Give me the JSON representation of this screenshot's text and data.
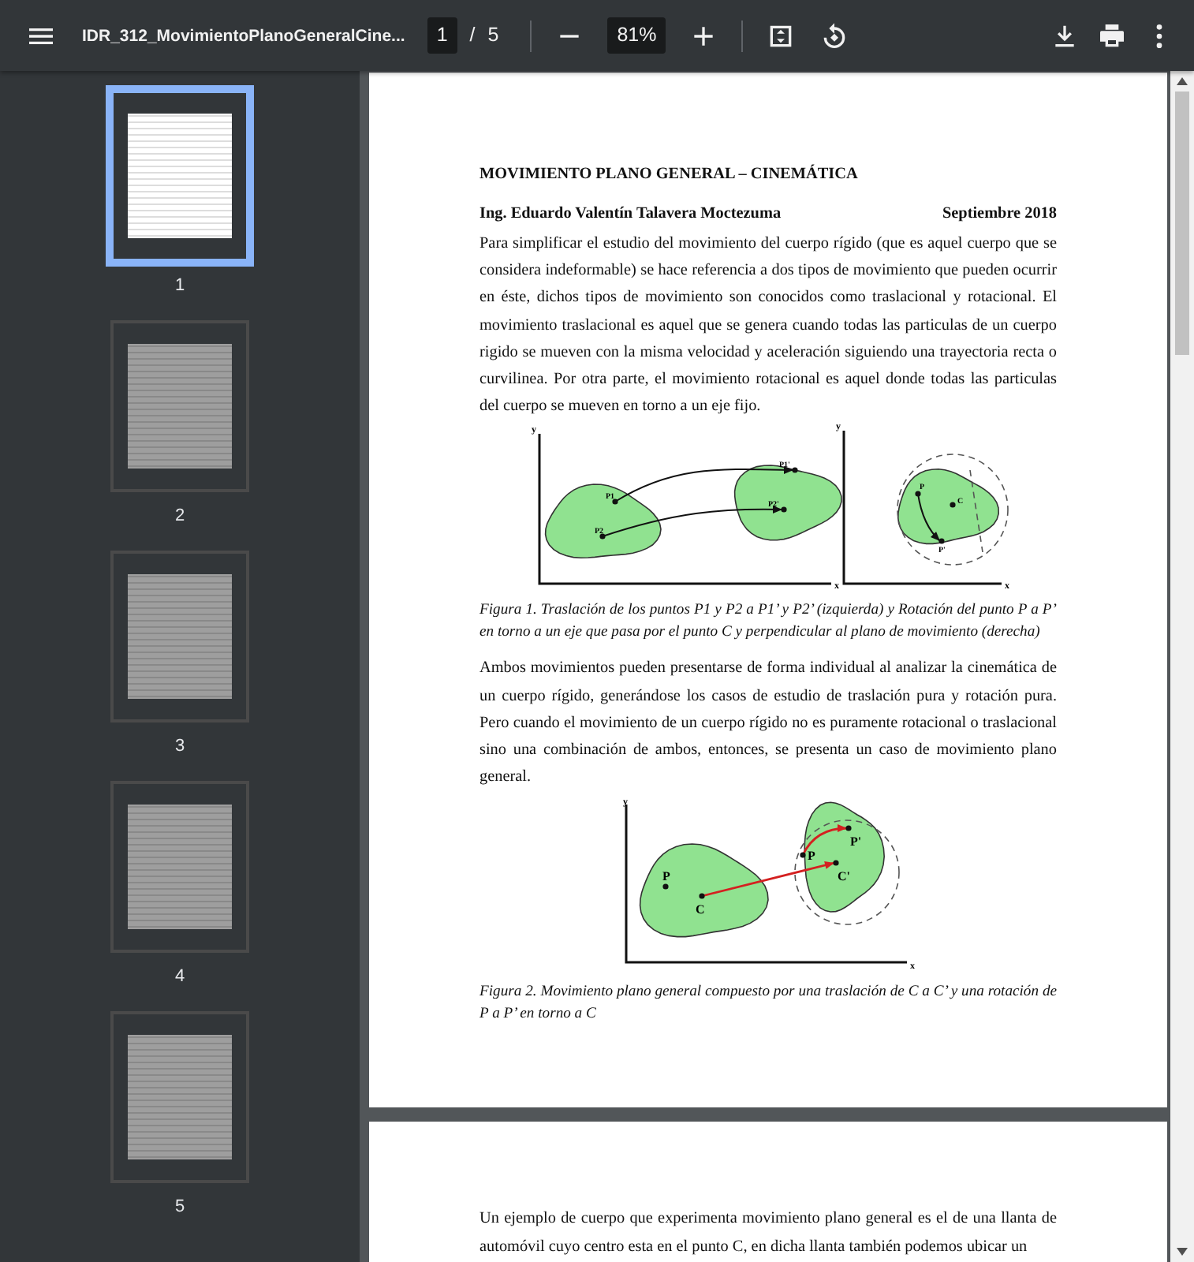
{
  "toolbar": {
    "title": "IDR_312_MovimientoPlanoGeneralCine...",
    "page_input": "1",
    "page_separator": "/",
    "page_total": "5",
    "zoom": "81%"
  },
  "thumbnails": [
    {
      "label": "1",
      "selected": true
    },
    {
      "label": "2",
      "selected": false
    },
    {
      "label": "3",
      "selected": false
    },
    {
      "label": "4",
      "selected": false
    },
    {
      "label": "5",
      "selected": false
    }
  ],
  "pages": [
    {
      "heading": "MOVIMIENTO PLANO GENERAL – CINEMÁTICA",
      "author": "Ing. Eduardo Valentín Talavera Moctezuma",
      "date": "Septiembre 2018",
      "blocks": [
        {
          "kind": "paragraph",
          "text": "Para simplificar el estudio del movimiento del cuerpo rígido (que es aquel cuerpo que se considera indeformable) se hace referencia a dos tipos de movimiento que pueden ocurrir en éste, dichos tipos de movimiento son conocidos como traslacional y rotacional. El movimiento traslacional es aquel que se genera cuando todas las particulas de un cuerpo rigido se mueven con la misma velocidad y aceleración siguiendo una trayectoria recta o curvilinea. Por otra parte, el movimiento rotacional es aquel donde todas las particulas del cuerpo se mueven en torno a un eje fijo."
        },
        {
          "kind": "translation",
          "labels": [
            "y",
            "x",
            "P1",
            "P2",
            "P1'",
            "P2'",
            "y",
            "x",
            "P",
            "C",
            "P'"
          ],
          "caption": "Figura 1. Traslación de los puntos P1 y P2 a P1’ y P2’ (izquierda) y Rotación del punto P a P’ en torno a un eje que pasa por el punto C y perpendicular al plano de movimiento (derecha)"
        },
        {
          "kind": "paragraph",
          "text": "Ambos movimientos pueden presentarse de forma individual al analizar la cinemática de un cuerpo rígido, generándose los casos de estudio de traslación pura y rotación pura. Pero cuando el movimiento de un cuerpo rígido no es puramente rotacional o traslacional sino una combinación de ambos, entonces, se presenta un caso de movimiento plano general."
        },
        {
          "kind": "planar",
          "labels": [
            "y",
            "x",
            "P",
            "C",
            "P",
            "P'",
            "C'"
          ],
          "caption": "Figura 2. Movimiento plano general compuesto por una traslación de C a C’ y una rotación de P a P’ en torno a C"
        }
      ]
    },
    {
      "blocks": [
        {
          "kind": "paragraph",
          "text": "Un ejemplo de cuerpo que experimenta movimiento plano general es el de una llanta de automóvil cuyo centro esta en el punto C, en dicha llanta también podemos ubicar un"
        }
      ]
    }
  ]
}
